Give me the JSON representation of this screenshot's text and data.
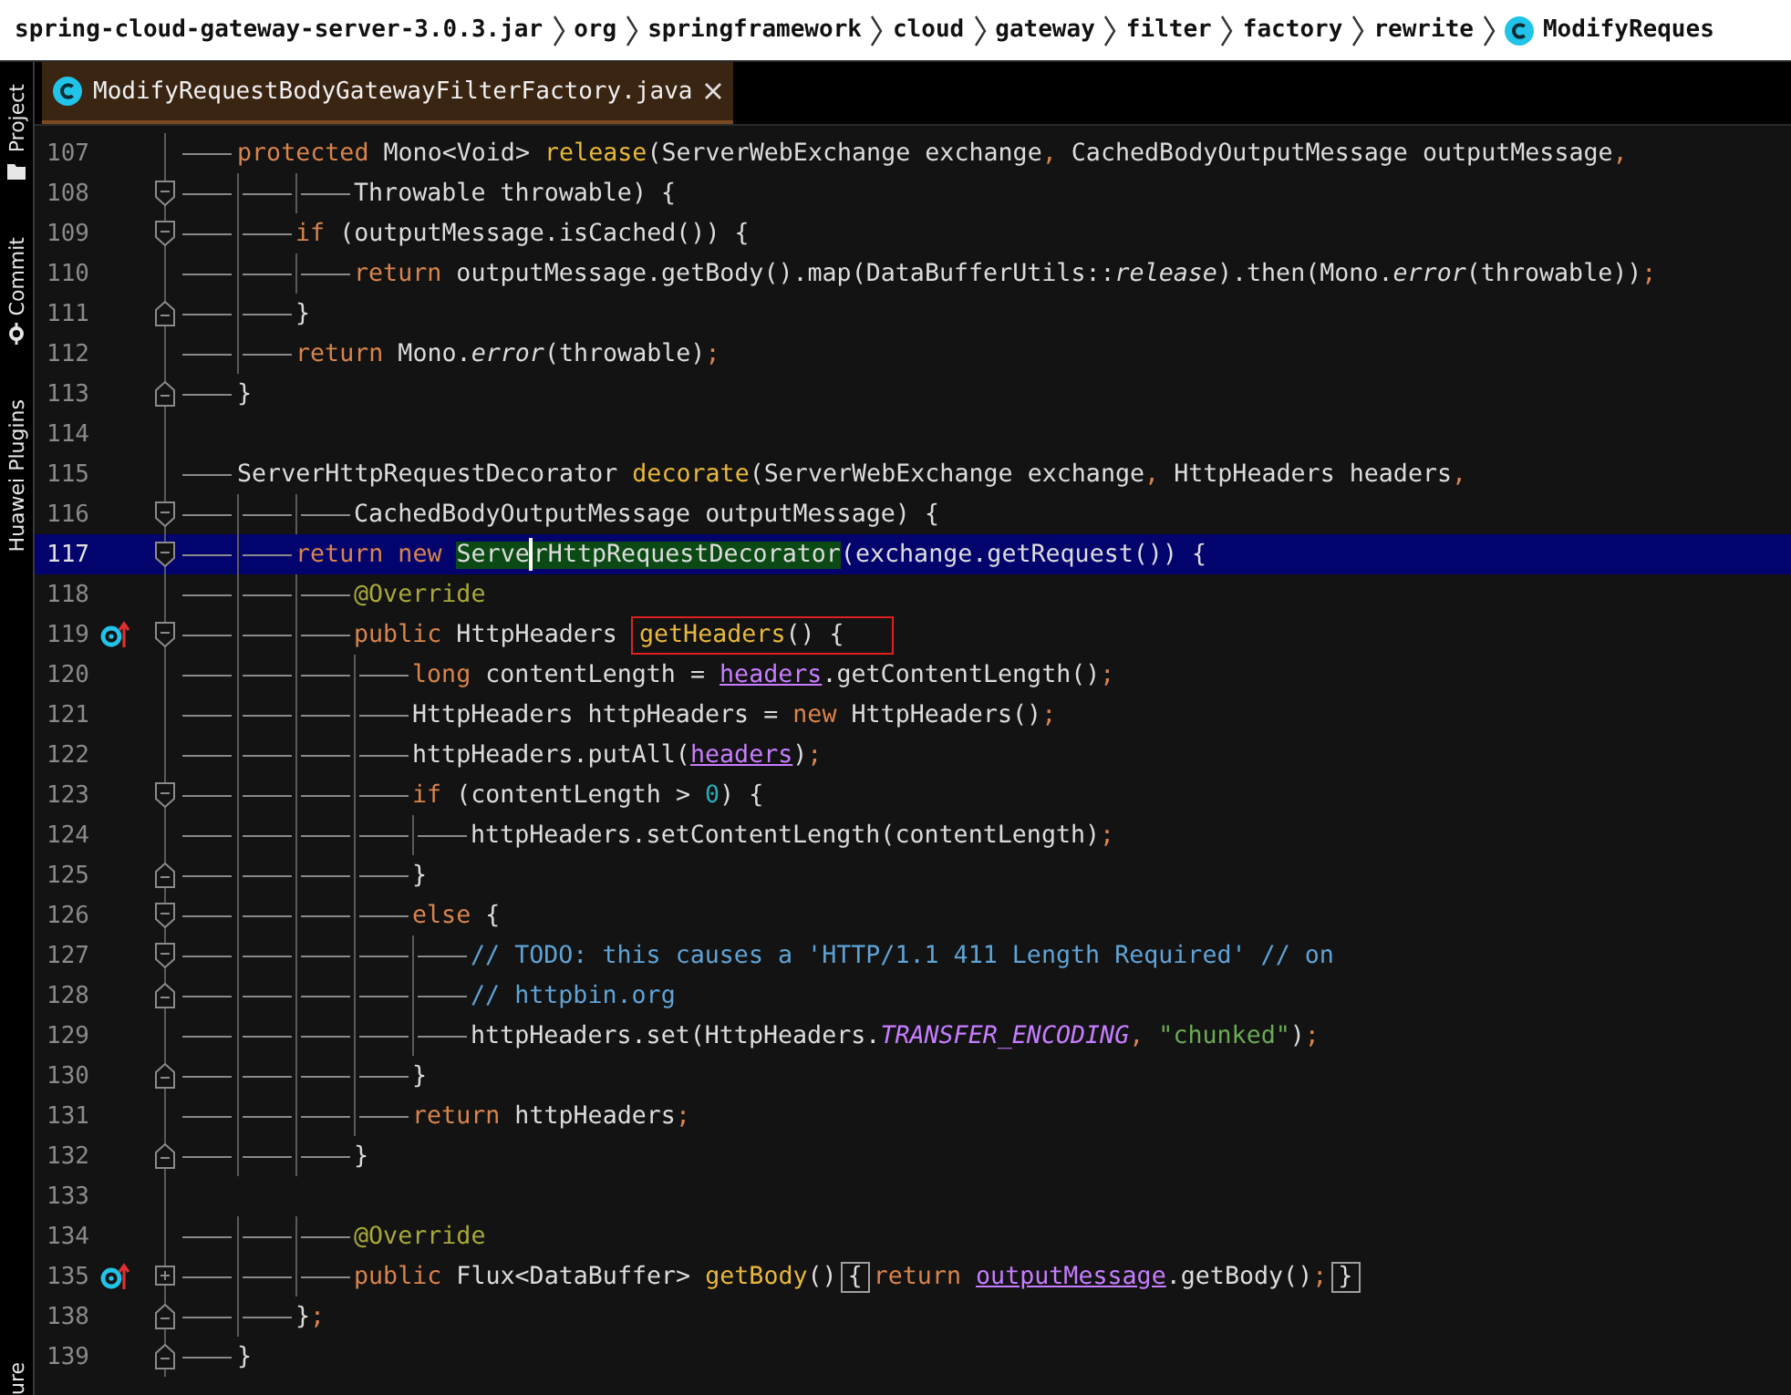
{
  "breadcrumb": {
    "items": [
      {
        "label": "spring-cloud-gateway-server-3.0.3.jar",
        "kind": "jar"
      },
      {
        "label": "org",
        "kind": "package"
      },
      {
        "label": "springframework",
        "kind": "package"
      },
      {
        "label": "cloud",
        "kind": "package"
      },
      {
        "label": "gateway",
        "kind": "package"
      },
      {
        "label": "filter",
        "kind": "package"
      },
      {
        "label": "factory",
        "kind": "package"
      },
      {
        "label": "rewrite",
        "kind": "package"
      },
      {
        "label": "ModifyReques",
        "kind": "class"
      }
    ]
  },
  "tool_strip": {
    "items": [
      {
        "label": "Project",
        "kind": "project"
      },
      {
        "label": "Commit",
        "kind": "commit"
      },
      {
        "label": "Huawei Plugins",
        "kind": "plain"
      },
      {
        "label": "ure",
        "kind": "bottom"
      }
    ]
  },
  "tabs": [
    {
      "title": "ModifyRequestBodyGatewayFilterFactory.java",
      "selected": true
    }
  ],
  "editor": {
    "lines": [
      {
        "number": "107",
        "tokens": [
          {
            "kind": "tab"
          },
          {
            "kind": "keyword",
            "text": "protected"
          },
          {
            "kind": "text",
            "text": " Mono<Void> "
          },
          {
            "kind": "method",
            "text": "release"
          },
          {
            "kind": "text",
            "text": "(ServerWebExchange exchange"
          },
          {
            "kind": "punct",
            "text": ","
          },
          {
            "kind": "text",
            "text": " CachedBodyOutputMessage outputMessage"
          },
          {
            "kind": "punct",
            "text": ","
          }
        ]
      },
      {
        "number": "108",
        "fold": {
          "kind": "open"
        },
        "tokens": [
          {
            "kind": "tab"
          },
          {
            "kind": "tab"
          },
          {
            "kind": "tab"
          },
          {
            "kind": "text",
            "text": "Throwable throwable) {"
          }
        ]
      },
      {
        "number": "109",
        "fold": {
          "kind": "open"
        },
        "tokens": [
          {
            "kind": "tab"
          },
          {
            "kind": "tab"
          },
          {
            "kind": "keyword",
            "text": "if"
          },
          {
            "kind": "text",
            "text": " (outputMessage.isCached()) {"
          }
        ]
      },
      {
        "number": "110",
        "tokens": [
          {
            "kind": "tab"
          },
          {
            "kind": "tab"
          },
          {
            "kind": "tab"
          },
          {
            "kind": "keyword",
            "text": "return"
          },
          {
            "kind": "text",
            "text": " outputMessage.getBody().map(DataBufferUtils::"
          },
          {
            "kind": "static",
            "text": "release"
          },
          {
            "kind": "text",
            "text": ").then(Mono."
          },
          {
            "kind": "static",
            "text": "error"
          },
          {
            "kind": "text",
            "text": "(throwable))"
          },
          {
            "kind": "punct",
            "text": ";"
          }
        ]
      },
      {
        "number": "111",
        "fold": {
          "kind": "close"
        },
        "tokens": [
          {
            "kind": "tab"
          },
          {
            "kind": "tab"
          },
          {
            "kind": "text",
            "text": "}"
          }
        ]
      },
      {
        "number": "112",
        "tokens": [
          {
            "kind": "tab"
          },
          {
            "kind": "tab"
          },
          {
            "kind": "keyword",
            "text": "return"
          },
          {
            "kind": "text",
            "text": " Mono."
          },
          {
            "kind": "static",
            "text": "error"
          },
          {
            "kind": "text",
            "text": "(throwable)"
          },
          {
            "kind": "punct",
            "text": ";"
          }
        ]
      },
      {
        "number": "113",
        "fold": {
          "kind": "close"
        },
        "tokens": [
          {
            "kind": "tab"
          },
          {
            "kind": "text",
            "text": "}"
          }
        ]
      },
      {
        "number": "114"
      },
      {
        "number": "115",
        "tokens": [
          {
            "kind": "tab"
          },
          {
            "kind": "text",
            "text": "ServerHttpRequestDecorator "
          },
          {
            "kind": "method",
            "text": "decorate"
          },
          {
            "kind": "text",
            "text": "(ServerWebExchange exchange"
          },
          {
            "kind": "punct",
            "text": ","
          },
          {
            "kind": "text",
            "text": " HttpHeaders headers"
          },
          {
            "kind": "punct",
            "text": ","
          }
        ]
      },
      {
        "number": "116",
        "fold": {
          "kind": "open"
        },
        "tokens": [
          {
            "kind": "tab"
          },
          {
            "kind": "tab"
          },
          {
            "kind": "tab"
          },
          {
            "kind": "text",
            "text": "CachedBodyOutputMessage outputMessage) {"
          }
        ]
      },
      {
        "number": "117",
        "fold": {
          "kind": "open"
        },
        "current": true,
        "tokens": [
          {
            "kind": "tab"
          },
          {
            "kind": "tab"
          },
          {
            "kind": "keyword",
            "text": "return new "
          },
          {
            "kind": "match",
            "text": "Serve"
          },
          {
            "kind": "caret"
          },
          {
            "kind": "match",
            "text": "rHttpRequestDecorator"
          },
          {
            "kind": "text",
            "text": "(exchange.getRequest()) {"
          }
        ]
      },
      {
        "number": "118",
        "tokens": [
          {
            "kind": "tab"
          },
          {
            "kind": "tab"
          },
          {
            "kind": "tab"
          },
          {
            "kind": "annotation",
            "text": "@Override"
          }
        ]
      },
      {
        "number": "119",
        "marker": {
          "kind": "override"
        },
        "fold": {
          "kind": "open"
        },
        "tokens": [
          {
            "kind": "tab"
          },
          {
            "kind": "tab"
          },
          {
            "kind": "tab"
          },
          {
            "kind": "keyword",
            "text": "public"
          },
          {
            "kind": "text",
            "text": " HttpHeaders "
          },
          {
            "kind": "frame",
            "tokens": [
              {
                "kind": "method",
                "text": "getHeaders"
              },
              {
                "kind": "text",
                "text": "() {"
              }
            ]
          }
        ]
      },
      {
        "number": "120",
        "tokens": [
          {
            "kind": "tab"
          },
          {
            "kind": "tab"
          },
          {
            "kind": "tab"
          },
          {
            "kind": "tab"
          },
          {
            "kind": "keyword",
            "text": "long"
          },
          {
            "kind": "text",
            "text": " contentLength = "
          },
          {
            "kind": "field",
            "text": "headers"
          },
          {
            "kind": "text",
            "text": ".getContentLength()"
          },
          {
            "kind": "punct",
            "text": ";"
          }
        ]
      },
      {
        "number": "121",
        "tokens": [
          {
            "kind": "tab"
          },
          {
            "kind": "tab"
          },
          {
            "kind": "tab"
          },
          {
            "kind": "tab"
          },
          {
            "kind": "text",
            "text": "HttpHeaders httpHeaders = "
          },
          {
            "kind": "keyword",
            "text": "new"
          },
          {
            "kind": "text",
            "text": " HttpHeaders()"
          },
          {
            "kind": "punct",
            "text": ";"
          }
        ]
      },
      {
        "number": "122",
        "tokens": [
          {
            "kind": "tab"
          },
          {
            "kind": "tab"
          },
          {
            "kind": "tab"
          },
          {
            "kind": "tab"
          },
          {
            "kind": "text",
            "text": "httpHeaders.putAll("
          },
          {
            "kind": "field",
            "text": "headers"
          },
          {
            "kind": "text",
            "text": ")"
          },
          {
            "kind": "punct",
            "text": ";"
          }
        ]
      },
      {
        "number": "123",
        "fold": {
          "kind": "open"
        },
        "tokens": [
          {
            "kind": "tab"
          },
          {
            "kind": "tab"
          },
          {
            "kind": "tab"
          },
          {
            "kind": "tab"
          },
          {
            "kind": "keyword",
            "text": "if"
          },
          {
            "kind": "text",
            "text": " (contentLength > "
          },
          {
            "kind": "number",
            "text": "0"
          },
          {
            "kind": "text",
            "text": ") {"
          }
        ]
      },
      {
        "number": "124",
        "tokens": [
          {
            "kind": "tab"
          },
          {
            "kind": "tab"
          },
          {
            "kind": "tab"
          },
          {
            "kind": "tab"
          },
          {
            "kind": "tab"
          },
          {
            "kind": "text",
            "text": "httpHeaders.setContentLength(contentLength)"
          },
          {
            "kind": "punct",
            "text": ";"
          }
        ]
      },
      {
        "number": "125",
        "fold": {
          "kind": "close"
        },
        "tokens": [
          {
            "kind": "tab"
          },
          {
            "kind": "tab"
          },
          {
            "kind": "tab"
          },
          {
            "kind": "tab"
          },
          {
            "kind": "text",
            "text": "}"
          }
        ]
      },
      {
        "number": "126",
        "fold": {
          "kind": "open"
        },
        "tokens": [
          {
            "kind": "tab"
          },
          {
            "kind": "tab"
          },
          {
            "kind": "tab"
          },
          {
            "kind": "tab"
          },
          {
            "kind": "keyword",
            "text": "else"
          },
          {
            "kind": "text",
            "text": " {"
          }
        ]
      },
      {
        "number": "127",
        "fold": {
          "kind": "open"
        },
        "tokens": [
          {
            "kind": "tab"
          },
          {
            "kind": "tab"
          },
          {
            "kind": "tab"
          },
          {
            "kind": "tab"
          },
          {
            "kind": "tab"
          },
          {
            "kind": "comment",
            "text": "// TODO: this causes a 'HTTP/1.1 411 Length Required' // on"
          }
        ]
      },
      {
        "number": "128",
        "fold": {
          "kind": "close"
        },
        "tokens": [
          {
            "kind": "tab"
          },
          {
            "kind": "tab"
          },
          {
            "kind": "tab"
          },
          {
            "kind": "tab"
          },
          {
            "kind": "tab"
          },
          {
            "kind": "comment",
            "text": "// httpbin.org"
          }
        ]
      },
      {
        "number": "129",
        "tokens": [
          {
            "kind": "tab"
          },
          {
            "kind": "tab"
          },
          {
            "kind": "tab"
          },
          {
            "kind": "tab"
          },
          {
            "kind": "tab"
          },
          {
            "kind": "text",
            "text": "httpHeaders.set(HttpHeaders."
          },
          {
            "kind": "constant",
            "text": "TRANSFER_ENCODING"
          },
          {
            "kind": "punct",
            "text": ", "
          },
          {
            "kind": "string",
            "text": "\"chunked\""
          },
          {
            "kind": "text",
            "text": ")"
          },
          {
            "kind": "punct",
            "text": ";"
          }
        ]
      },
      {
        "number": "130",
        "fold": {
          "kind": "close"
        },
        "tokens": [
          {
            "kind": "tab"
          },
          {
            "kind": "tab"
          },
          {
            "kind": "tab"
          },
          {
            "kind": "tab"
          },
          {
            "kind": "text",
            "text": "}"
          }
        ]
      },
      {
        "number": "131",
        "tokens": [
          {
            "kind": "tab"
          },
          {
            "kind": "tab"
          },
          {
            "kind": "tab"
          },
          {
            "kind": "tab"
          },
          {
            "kind": "keyword",
            "text": "return"
          },
          {
            "kind": "text",
            "text": " httpHeaders"
          },
          {
            "kind": "punct",
            "text": ";"
          }
        ]
      },
      {
        "number": "132",
        "fold": {
          "kind": "close"
        },
        "tokens": [
          {
            "kind": "tab"
          },
          {
            "kind": "tab"
          },
          {
            "kind": "tab"
          },
          {
            "kind": "text",
            "text": "}"
          }
        ]
      },
      {
        "number": "133"
      },
      {
        "number": "134",
        "tokens": [
          {
            "kind": "tab"
          },
          {
            "kind": "tab"
          },
          {
            "kind": "tab"
          },
          {
            "kind": "annotation",
            "text": "@Override"
          }
        ]
      },
      {
        "number": "135",
        "marker": {
          "kind": "override"
        },
        "fold": {
          "kind": "collapsed"
        },
        "tokens": [
          {
            "kind": "tab"
          },
          {
            "kind": "tab"
          },
          {
            "kind": "tab"
          },
          {
            "kind": "keyword",
            "text": "public"
          },
          {
            "kind": "text",
            "text": " Flux<DataBuffer> "
          },
          {
            "kind": "method",
            "text": "getBody"
          },
          {
            "kind": "text",
            "text": "()"
          },
          {
            "kind": "brace",
            "text": "{"
          },
          {
            "kind": "keyword",
            "text": "return "
          },
          {
            "kind": "field",
            "text": "outputMessage"
          },
          {
            "kind": "text",
            "text": ".getBody()"
          },
          {
            "kind": "punct",
            "text": ";"
          },
          {
            "kind": "brace",
            "text": "}"
          }
        ]
      },
      {
        "number": "138",
        "fold": {
          "kind": "close"
        },
        "tokens": [
          {
            "kind": "tab"
          },
          {
            "kind": "tab"
          },
          {
            "kind": "text",
            "text": "}"
          },
          {
            "kind": "punct",
            "text": ";"
          }
        ]
      },
      {
        "number": "139",
        "fold": {
          "kind": "close"
        },
        "tokens": [
          {
            "kind": "tab"
          },
          {
            "kind": "text",
            "text": "}"
          }
        ]
      }
    ]
  }
}
